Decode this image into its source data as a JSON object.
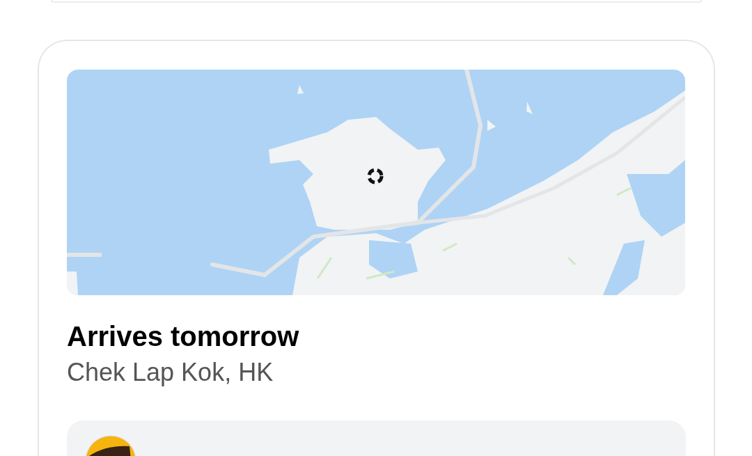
{
  "shipment": {
    "eta": "Arrives tomorrow",
    "location": "Chek Lap Kok, HK"
  }
}
